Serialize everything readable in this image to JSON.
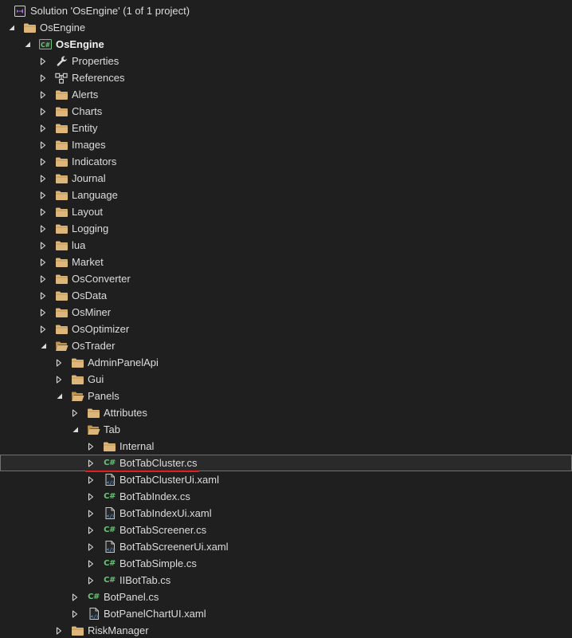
{
  "solution": {
    "title": "Solution 'OsEngine' (1 of 1 project)"
  },
  "tree": [
    {
      "label": "OsEngine",
      "depth": 0,
      "icon": "folder-icon",
      "arrow": "expanded"
    },
    {
      "label": "OsEngine",
      "depth": 1,
      "icon": "csharp-project-icon",
      "arrow": "expanded",
      "bold": true
    },
    {
      "label": "Properties",
      "depth": 2,
      "icon": "wrench-icon",
      "arrow": "collapsed"
    },
    {
      "label": "References",
      "depth": 2,
      "icon": "references-icon",
      "arrow": "collapsed"
    },
    {
      "label": "Alerts",
      "depth": 2,
      "icon": "folder-icon",
      "arrow": "collapsed"
    },
    {
      "label": "Charts",
      "depth": 2,
      "icon": "folder-icon",
      "arrow": "collapsed"
    },
    {
      "label": "Entity",
      "depth": 2,
      "icon": "folder-icon",
      "arrow": "collapsed"
    },
    {
      "label": "Images",
      "depth": 2,
      "icon": "folder-icon",
      "arrow": "collapsed"
    },
    {
      "label": "Indicators",
      "depth": 2,
      "icon": "folder-icon",
      "arrow": "collapsed"
    },
    {
      "label": "Journal",
      "depth": 2,
      "icon": "folder-icon",
      "arrow": "collapsed"
    },
    {
      "label": "Language",
      "depth": 2,
      "icon": "folder-icon",
      "arrow": "collapsed"
    },
    {
      "label": "Layout",
      "depth": 2,
      "icon": "folder-icon",
      "arrow": "collapsed"
    },
    {
      "label": "Logging",
      "depth": 2,
      "icon": "folder-icon",
      "arrow": "collapsed"
    },
    {
      "label": "lua",
      "depth": 2,
      "icon": "folder-icon",
      "arrow": "collapsed"
    },
    {
      "label": "Market",
      "depth": 2,
      "icon": "folder-icon",
      "arrow": "collapsed"
    },
    {
      "label": "OsConverter",
      "depth": 2,
      "icon": "folder-icon",
      "arrow": "collapsed"
    },
    {
      "label": "OsData",
      "depth": 2,
      "icon": "folder-icon",
      "arrow": "collapsed"
    },
    {
      "label": "OsMiner",
      "depth": 2,
      "icon": "folder-icon",
      "arrow": "collapsed"
    },
    {
      "label": "OsOptimizer",
      "depth": 2,
      "icon": "folder-icon",
      "arrow": "collapsed"
    },
    {
      "label": "OsTrader",
      "depth": 2,
      "icon": "folder-open-icon",
      "arrow": "expanded"
    },
    {
      "label": "AdminPanelApi",
      "depth": 3,
      "icon": "folder-icon",
      "arrow": "collapsed"
    },
    {
      "label": "Gui",
      "depth": 3,
      "icon": "folder-icon",
      "arrow": "collapsed"
    },
    {
      "label": "Panels",
      "depth": 3,
      "icon": "folder-open-icon",
      "arrow": "expanded"
    },
    {
      "label": "Attributes",
      "depth": 4,
      "icon": "folder-icon",
      "arrow": "collapsed"
    },
    {
      "label": "Tab",
      "depth": 4,
      "icon": "folder-open-icon",
      "arrow": "expanded"
    },
    {
      "label": "Internal",
      "depth": 5,
      "icon": "folder-icon",
      "arrow": "collapsed"
    },
    {
      "label": "BotTabCluster.cs",
      "depth": 5,
      "icon": "csharp-file-icon",
      "arrow": "collapsed",
      "selected": true,
      "underline": true
    },
    {
      "label": "BotTabClusterUi.xaml",
      "depth": 5,
      "icon": "xaml-file-icon",
      "arrow": "collapsed"
    },
    {
      "label": "BotTabIndex.cs",
      "depth": 5,
      "icon": "csharp-file-icon",
      "arrow": "collapsed"
    },
    {
      "label": "BotTabIndexUi.xaml",
      "depth": 5,
      "icon": "xaml-file-icon",
      "arrow": "collapsed"
    },
    {
      "label": "BotTabScreener.cs",
      "depth": 5,
      "icon": "csharp-file-icon",
      "arrow": "collapsed"
    },
    {
      "label": "BotTabScreenerUi.xaml",
      "depth": 5,
      "icon": "xaml-file-icon",
      "arrow": "collapsed"
    },
    {
      "label": "BotTabSimple.cs",
      "depth": 5,
      "icon": "csharp-file-icon",
      "arrow": "collapsed"
    },
    {
      "label": "IIBotTab.cs",
      "depth": 5,
      "icon": "csharp-file-icon",
      "arrow": "collapsed"
    },
    {
      "label": "BotPanel.cs",
      "depth": 4,
      "icon": "csharp-file-icon",
      "arrow": "collapsed"
    },
    {
      "label": "BotPanelChartUI.xaml",
      "depth": 4,
      "icon": "xaml-file-icon",
      "arrow": "collapsed"
    },
    {
      "label": "RiskManager",
      "depth": 3,
      "icon": "folder-icon",
      "arrow": "collapsed"
    }
  ],
  "colors": {
    "background": "#1f1f1f",
    "folder": "#dcb67a",
    "folder_dark": "#c09553",
    "csharp": "#6dc27a",
    "vs_purple": "#9b6fd6",
    "selection_border": "#707070",
    "underline": "#e02020",
    "text": "#dcdcdc"
  },
  "icon_glyphs": {
    "csharp": "C#"
  }
}
